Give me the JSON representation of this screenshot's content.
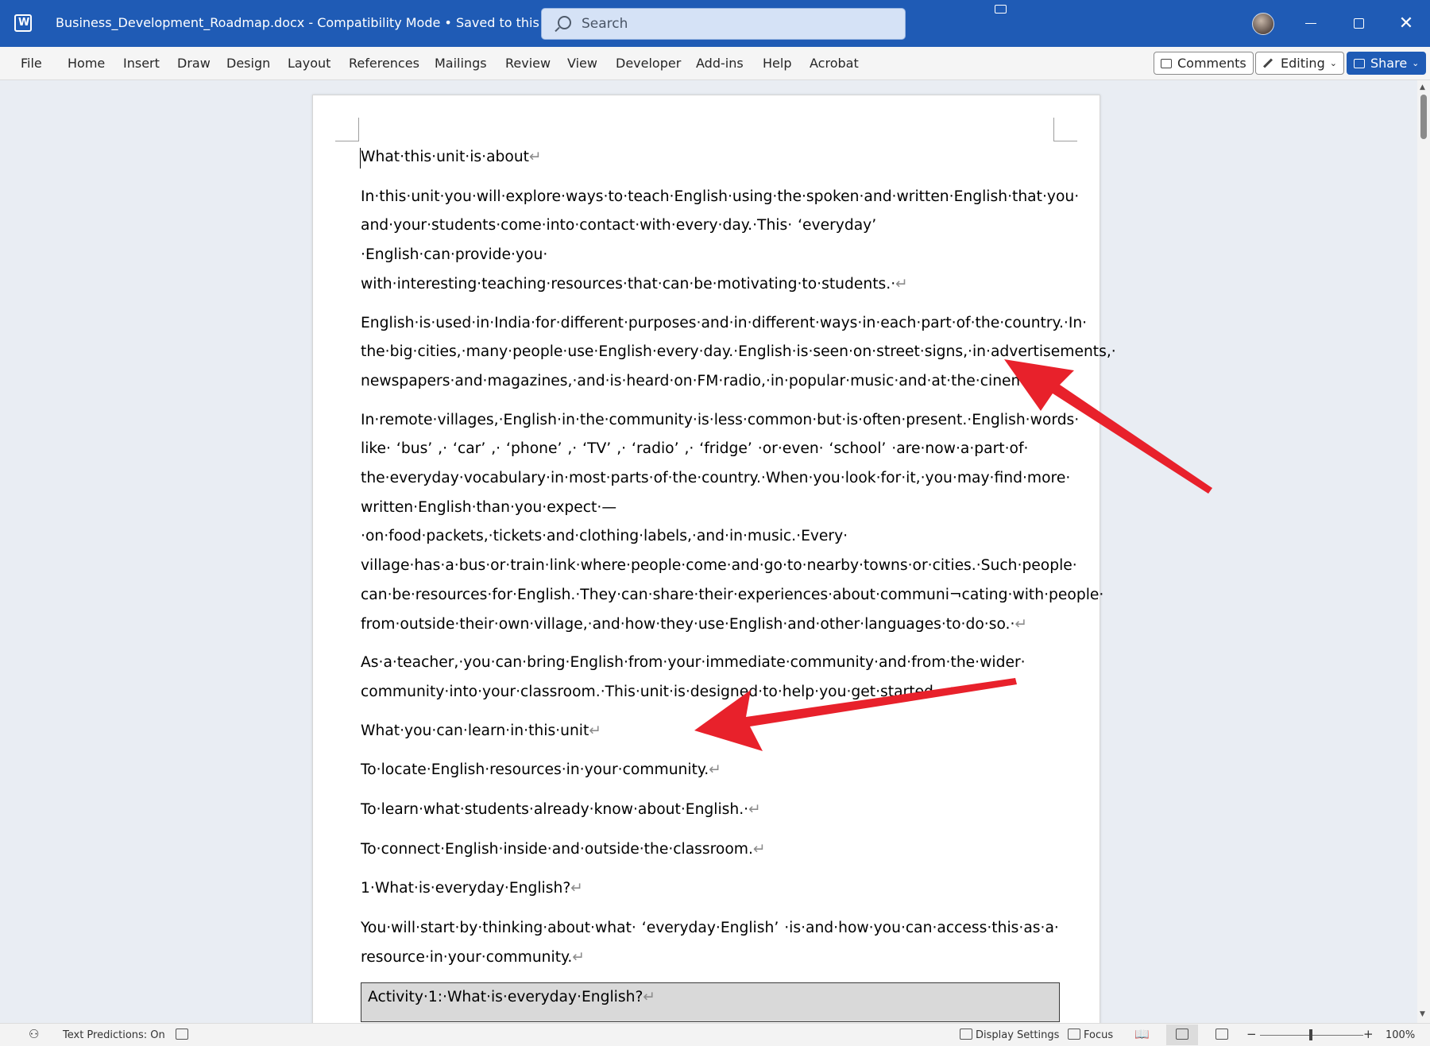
{
  "titlebar": {
    "doc_title": "Business_Development_Roadmap.docx  -  Compatibility Mode  •  Saved to this PC",
    "search_placeholder": "Search"
  },
  "menu": {
    "items": [
      "File",
      "Home",
      "Insert",
      "Draw",
      "Design",
      "Layout",
      "References",
      "Mailings",
      "Review",
      "View",
      "Developer",
      "Add-ins",
      "Help",
      "Acrobat"
    ],
    "comments_label": "Comments",
    "editing_label": "Editing",
    "share_label": "Share"
  },
  "document": {
    "heading1": "What·this·unit·is·about",
    "p1": "In·this·unit·you·will·explore·ways·to·teach·English·using·the·spoken·and·written·English·that·you· and·your·students·come·into·contact·with·every·day.·This· ‘everyday’ ·English·can·provide·you· with·interesting·teaching·resources·that·can·be·motivating·to·students.·",
    "p2": "English·is·used·in·India·for·different·purposes·and·in·different·ways·in·each·part·of·the·country.·In· the·big·cities,·many·people·use·English·every·day.·English·is·seen·on·street·signs,·in·advertisements,· newspapers·and·magazines,·and·is·heard·on·FM·radio,·in·popular·music·and·at·the·cinema.·",
    "p3": "In·remote·villages,·English·in·the·community·is·less·common·but·is·often·present.·English·words· like· ‘bus’ ,· ‘car’ ,· ‘phone’ ,· ‘TV’ ,· ‘radio’ ,· ‘fridge’ ·or·even· ‘school’ ·are·now·a·part·of· the·everyday·vocabulary·in·most·parts·of·the·country.·When·you·look·for·it,·you·may·find·more· written·English·than·you·expect·—·on·food·packets,·tickets·and·clothing·labels,·and·in·music.·Every· village·has·a·bus·or·train·link·where·people·come·and·go·to·nearby·towns·or·cities.·Such·people· can·be·resources·for·English.·They·can·share·their·experiences·about·communi¬cating·with·people· from·outside·their·own·village,·and·how·they·use·English·and·other·languages·to·do·so.·",
    "p4": "As·a·teacher,·you·can·bring·English·from·your·immediate·community·and·from·the·wider· community·into·your·classroom.·This·unit·is·designed·to·help·you·get·started.·",
    "heading2": "What·you·can·learn·in·this·unit",
    "li1": "To·locate·English·resources·in·your·community.",
    "li2": "To·learn·what·students·already·know·about·English.·",
    "li3": "To·connect·English·inside·and·outside·the·classroom.",
    "heading3": "1·What·is·everyday·English?",
    "p5": "You·will·start·by·thinking·about·what· ‘everyday·English’ ·is·and·how·you·can·access·this·as·a· resource·in·your·community.",
    "activity": "Activity·1:·What·is·everyday·English?",
    "para_mark": "↵"
  },
  "status": {
    "text_predictions": "Text Predictions: On",
    "display_settings": "Display Settings",
    "focus": "Focus",
    "zoom_minus": "−",
    "zoom_plus": "+",
    "zoom_level": "100%"
  },
  "colors": {
    "title_bar": "#1f5bb5",
    "arrow": "#e8212b"
  }
}
